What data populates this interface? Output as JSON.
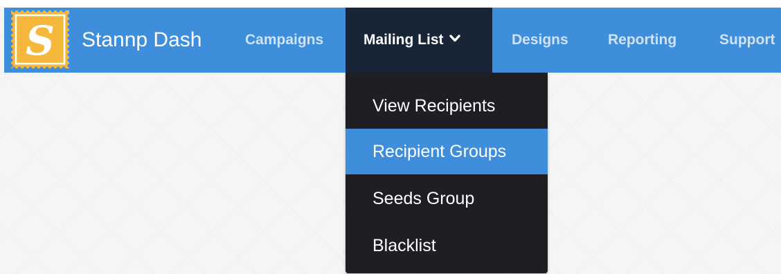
{
  "brand": {
    "logo_letter": "S",
    "name": "Stannp Dash"
  },
  "nav": {
    "items": [
      {
        "label": "Campaigns"
      },
      {
        "label": "Mailing List"
      },
      {
        "label": "Designs"
      },
      {
        "label": "Reporting"
      },
      {
        "label": "Support"
      }
    ],
    "active": "Mailing List"
  },
  "dropdown": {
    "items": [
      {
        "label": "View Recipients"
      },
      {
        "label": "Recipient Groups"
      },
      {
        "label": "Seeds Group"
      },
      {
        "label": "Blacklist"
      }
    ],
    "highlighted": "Recipient Groups"
  },
  "colors": {
    "navbar": "#3f8edb",
    "active_nav": "#172537",
    "dropdown_bg": "#1f1e22",
    "highlight": "#3f8edb",
    "logo_yellow": "#f6b83c"
  },
  "icons": {
    "logo": "stamp-logo-icon",
    "dropdown_indicator": "chevron-down-icon"
  }
}
